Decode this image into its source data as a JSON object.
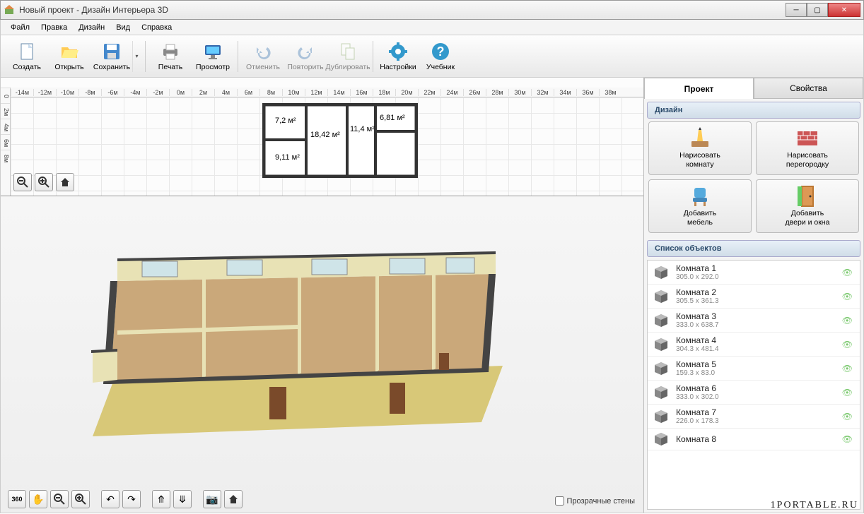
{
  "window": {
    "title": "Новый проект - Дизайн Интерьера 3D"
  },
  "menu": {
    "file": "Файл",
    "edit": "Правка",
    "design": "Дизайн",
    "view": "Вид",
    "help": "Справка"
  },
  "toolbar": {
    "create": "Создать",
    "open": "Открыть",
    "save": "Сохранить",
    "print": "Печать",
    "preview": "Просмотр",
    "undo": "Отменить",
    "redo": "Повторить",
    "duplicate": "Дублировать",
    "settings": "Настройки",
    "tutorial": "Учебник"
  },
  "ruler_h": [
    "-14м",
    "-12м",
    "-10м",
    "-8м",
    "-6м",
    "-4м",
    "-2м",
    "0м",
    "2м",
    "4м",
    "6м",
    "8м",
    "10м",
    "12м",
    "14м",
    "16м",
    "18м",
    "20м",
    "22м",
    "24м",
    "26м",
    "28м",
    "30м",
    "32м",
    "34м",
    "36м",
    "38м"
  ],
  "ruler_v": [
    "0",
    "2м",
    "4м",
    "6м",
    "8м"
  ],
  "plan": {
    "rooms": [
      {
        "label": "7,2 м²"
      },
      {
        "label": "18,42 м²"
      },
      {
        "label": "11,4 м²"
      },
      {
        "label": "6,81 м²"
      },
      {
        "label": "9,11 м²"
      }
    ]
  },
  "tabs": {
    "project": "Проект",
    "properties": "Свойства"
  },
  "design_section": "Дизайн",
  "tools": {
    "draw_room": "Нарисовать\nкомнату",
    "draw_partition": "Нарисовать\nперегородку",
    "add_furniture": "Добавить\nмебель",
    "add_doors": "Добавить\nдвери и окна"
  },
  "objects_section": "Список объектов",
  "objects": [
    {
      "name": "Комната 1",
      "dims": "305.0 x 292.0"
    },
    {
      "name": "Комната 2",
      "dims": "305.5 x 361.3"
    },
    {
      "name": "Комната 3",
      "dims": "333.0 x 638.7"
    },
    {
      "name": "Комната 4",
      "dims": "304.3 x 481.4"
    },
    {
      "name": "Комната 5",
      "dims": "159.3 x 83.0"
    },
    {
      "name": "Комната 6",
      "dims": "333.0 x 302.0"
    },
    {
      "name": "Комната 7",
      "dims": "226.0 x 178.3"
    },
    {
      "name": "Комната 8",
      "dims": ""
    }
  ],
  "transparent_walls": "Прозрачные стены",
  "watermark": "1PORTABLE.RU"
}
